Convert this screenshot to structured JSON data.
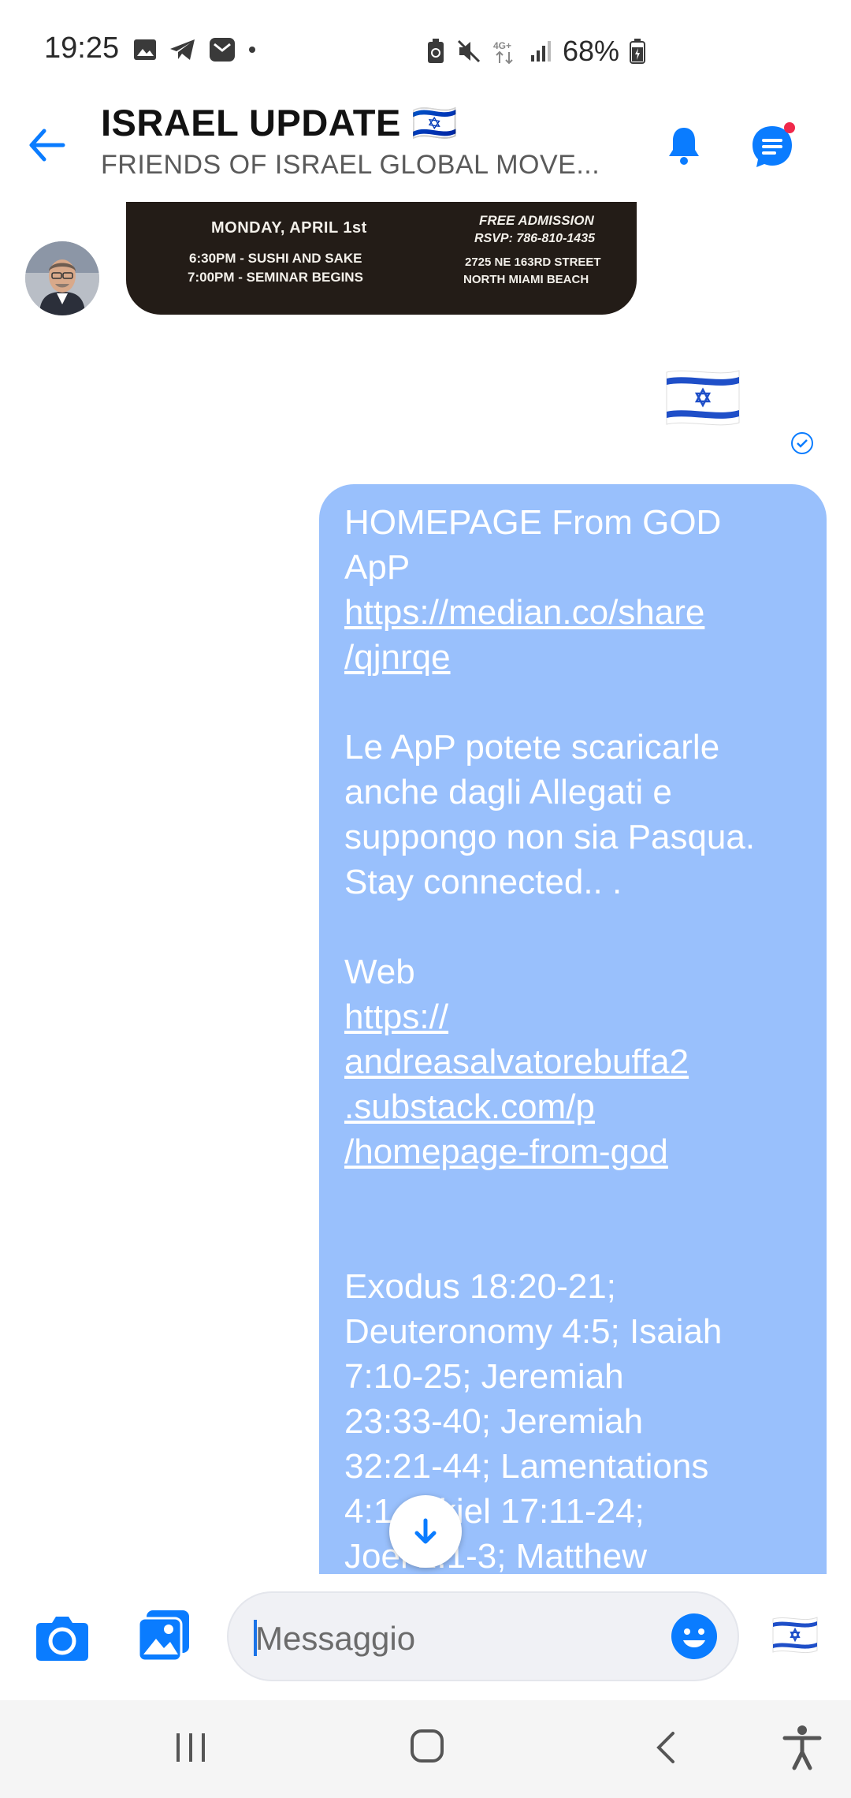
{
  "status_bar": {
    "time": "19:25",
    "battery": "68%",
    "network": "4G+"
  },
  "header": {
    "title": "ISRAEL UPDATE 🇮🇱",
    "subtitle": "FRIENDS OF ISRAEL GLOBAL MOVE..."
  },
  "event_image": {
    "date": "MONDAY,  APRIL 1st",
    "line1": "6:30PM - SUSHI AND SAKE",
    "line2": "7:00PM - SEMINAR BEGINS",
    "admission": "FREE ADMISSION",
    "rsvp": "RSVP: 786-810-1435",
    "address1": "2725 NE 163RD STREET",
    "address2": "NORTH MIAMI BEACH"
  },
  "message": {
    "l1": "HOMEPAGE From GOD",
    "l2": "ApP",
    "link1a": "https://median.co/share",
    "link1b": "/qjnrqe",
    "l3": "Le ApP potete scaricarle",
    "l4": "anche dagli Allegati e",
    "l5": "suppongo non sia Pasqua.",
    "l6": "Stay connected.. .",
    "l7": "Web",
    "link2a": "https://",
    "link2b": "andreasalvatorebuffa2",
    "link2c": ".substack.com/p",
    "link2d": "/homepage-from-god",
    "l8": "Exodus 18:20-21;",
    "l9": "Deuteronomy 4:5; Isaiah",
    "l10": "7:10-25; Jeremiah",
    "l11": "23:33-40; Jeremiah",
    "l12": "32:21-44; Lamentations",
    "l13": "4:1   zekiel 17:11-24;",
    "l14": "Joel 2:1-3; Matthew"
  },
  "composer": {
    "placeholder": "Messaggio"
  },
  "colors": {
    "accent": "#0a7cff",
    "bubble": "#99c0fc",
    "event_bg": "#231c17",
    "nav_bg": "#f5f5f5"
  }
}
